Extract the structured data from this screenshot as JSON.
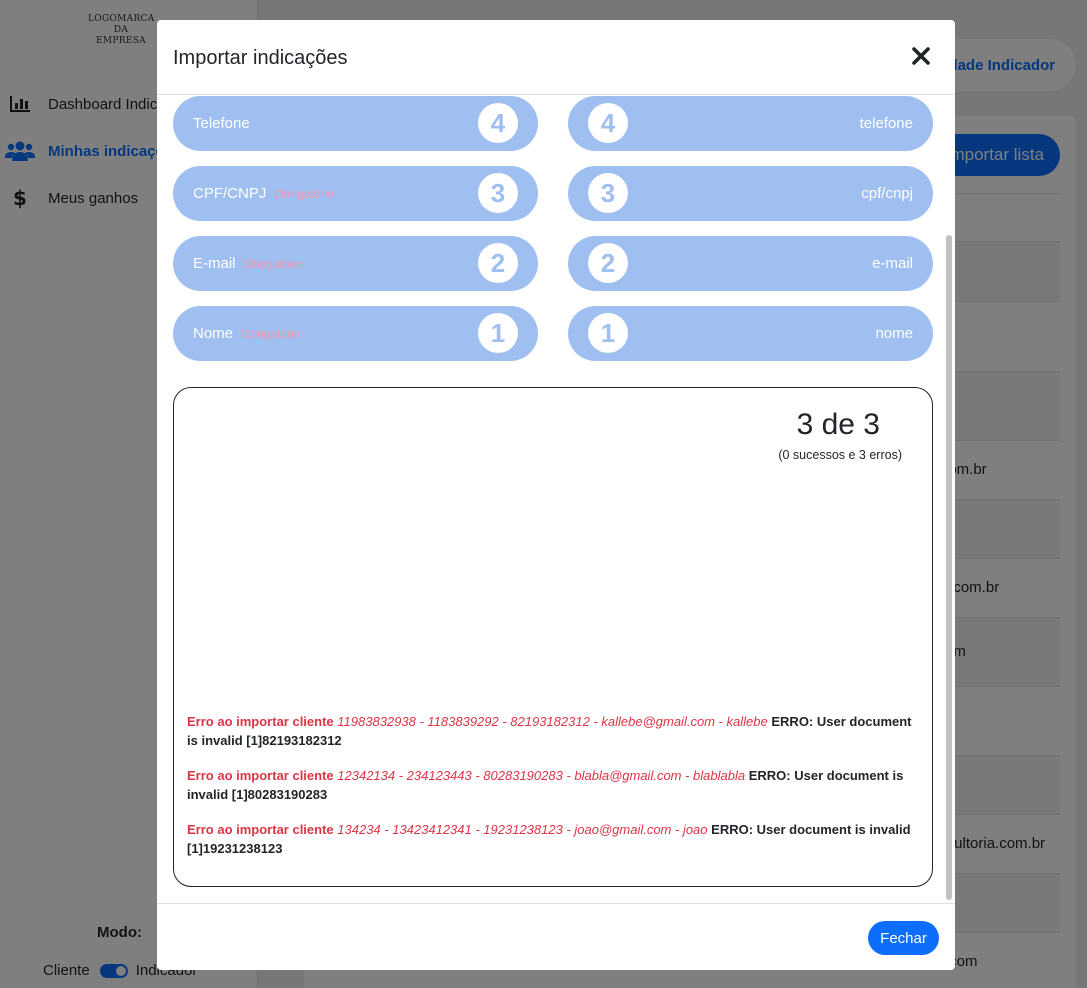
{
  "sidebar": {
    "logo": "LOGOMARCA DA EMPRESA",
    "items": [
      {
        "label": "Dashboard Indicador",
        "icon": "chart-bar-icon"
      },
      {
        "label": "Minhas indicações",
        "icon": "users-icon"
      },
      {
        "label": "Meus ganhos",
        "icon": "dollar-icon"
      }
    ],
    "mode_label": "Modo:",
    "mode_left": "Cliente",
    "mode_right": "Indicador"
  },
  "background": {
    "top_button": "Modalidade Indicador",
    "import_button": "Importar lista",
    "row_fragments": [
      "m",
      "il.com.br",
      "ital.com.br",
      "l.com",
      "onsultoria.com.br",
      "ail.com"
    ]
  },
  "modal": {
    "title": "Importar indicações",
    "required_label": "Obrigatório",
    "fields": [
      {
        "name": "Telefone",
        "required": false,
        "number": "4",
        "column": "telefone"
      },
      {
        "name": "CPF/CNPJ",
        "required": true,
        "number": "3",
        "column": "cpf/cnpj"
      },
      {
        "name": "E-mail",
        "required": true,
        "number": "2",
        "column": "e-mail"
      },
      {
        "name": "Nome",
        "required": true,
        "number": "1",
        "column": "nome"
      }
    ],
    "count": "3 de 3",
    "summary": "(0 sucessos e 3 erros)",
    "errors": [
      {
        "label": "Erro ao importar cliente",
        "data": "11983832938 - 1183839292 - 82193182312 - kallebe@gmail.com - kallebe",
        "message": "ERRO: User document is invalid [1]82193182312"
      },
      {
        "label": "Erro ao importar cliente",
        "data": "12342134 - 234123443 - 80283190283 - blabla@gmail.com - blablabla",
        "message": "ERRO: User document is invalid [1]80283190283"
      },
      {
        "label": "Erro ao importar cliente",
        "data": "134234 - 13423412341 - 19231238123 - joao@gmail.com - joao",
        "message": "ERRO: User document is invalid [1]19231238123"
      }
    ],
    "close_button": "Fechar"
  },
  "colors": {
    "primary": "#0d6efd",
    "field_bg": "#9fbff0",
    "error": "#dc3545",
    "required": "#f29ab0"
  }
}
